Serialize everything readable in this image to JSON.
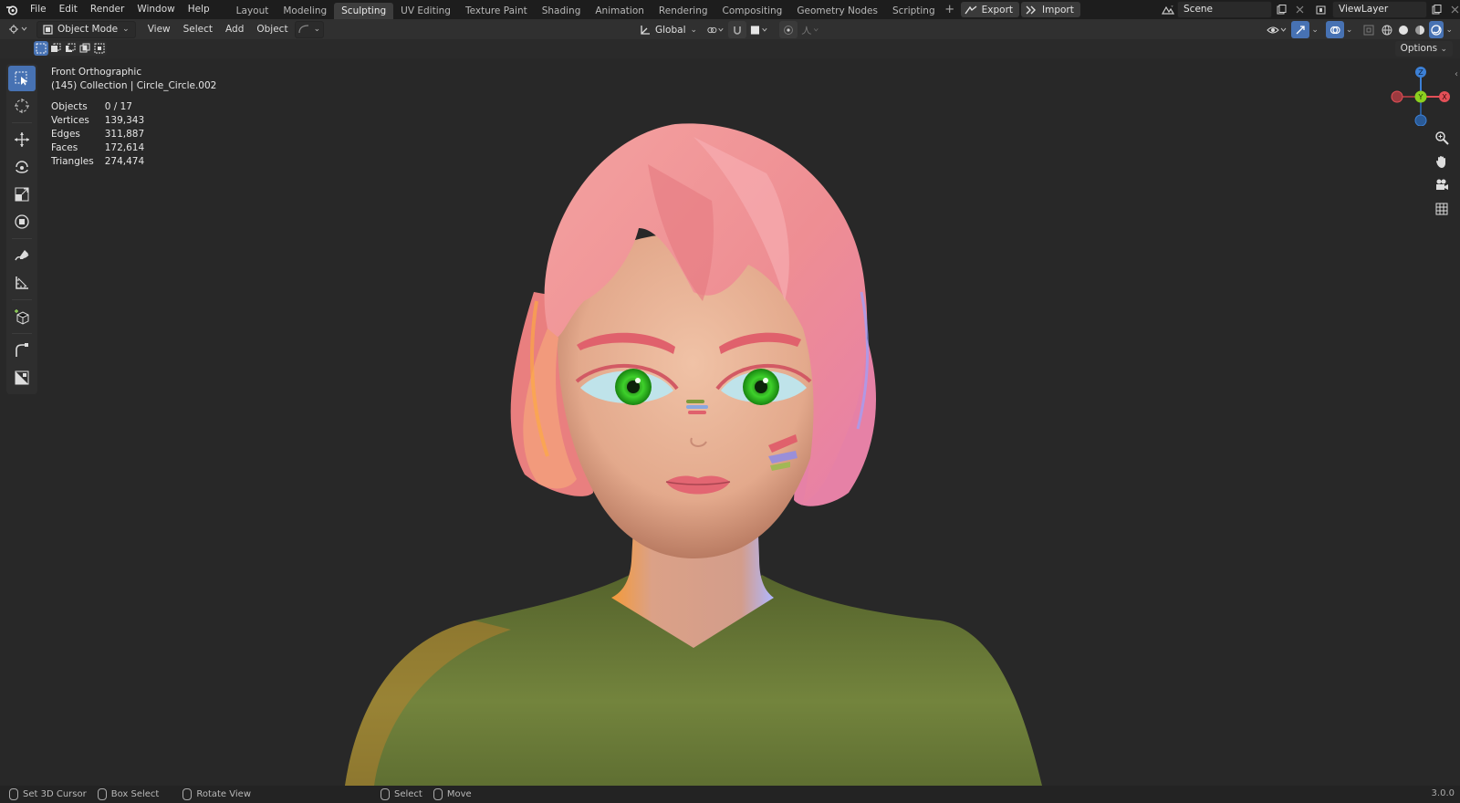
{
  "topbar": {
    "menu": [
      "File",
      "Edit",
      "Render",
      "Window",
      "Help"
    ],
    "workspaces": [
      "Layout",
      "Modeling",
      "Sculpting",
      "UV Editing",
      "Texture Paint",
      "Shading",
      "Animation",
      "Rendering",
      "Compositing",
      "Geometry Nodes",
      "Scripting"
    ],
    "active_workspace": "Sculpting",
    "add_workspace": "+",
    "export_label": "Export",
    "import_label": "Import",
    "scene_value": "Scene",
    "viewlayer_value": "ViewLayer"
  },
  "header": {
    "mode_label": "Object Mode",
    "menu": [
      "View",
      "Select",
      "Add",
      "Object"
    ],
    "transform_orientation": "Global",
    "options_label": "Options"
  },
  "viewport": {
    "view_name": "Front Orthographic",
    "collection_info": "(145) Collection | Circle_Circle.002",
    "stats": [
      {
        "label": "Objects",
        "value": "0 / 17"
      },
      {
        "label": "Vertices",
        "value": "139,343"
      },
      {
        "label": "Edges",
        "value": "311,887"
      },
      {
        "label": "Faces",
        "value": "172,614"
      },
      {
        "label": "Triangles",
        "value": "274,474"
      }
    ],
    "gizmo_axes": {
      "z": "Z",
      "y": "Y",
      "x": "X"
    }
  },
  "statusbar": {
    "items": [
      "Set 3D Cursor",
      "Box Select",
      "Rotate View",
      "Select",
      "Move"
    ],
    "version": "3.0.0"
  },
  "colors": {
    "accent": "#4772b3",
    "axis_x": "#e34f57",
    "axis_y": "#8bd01f",
    "axis_z": "#3c80d6",
    "hair": "#ef8a8d",
    "skin": "#e9b59c",
    "shirt": "#6b7a3a",
    "eyes": "#3ed12b"
  }
}
